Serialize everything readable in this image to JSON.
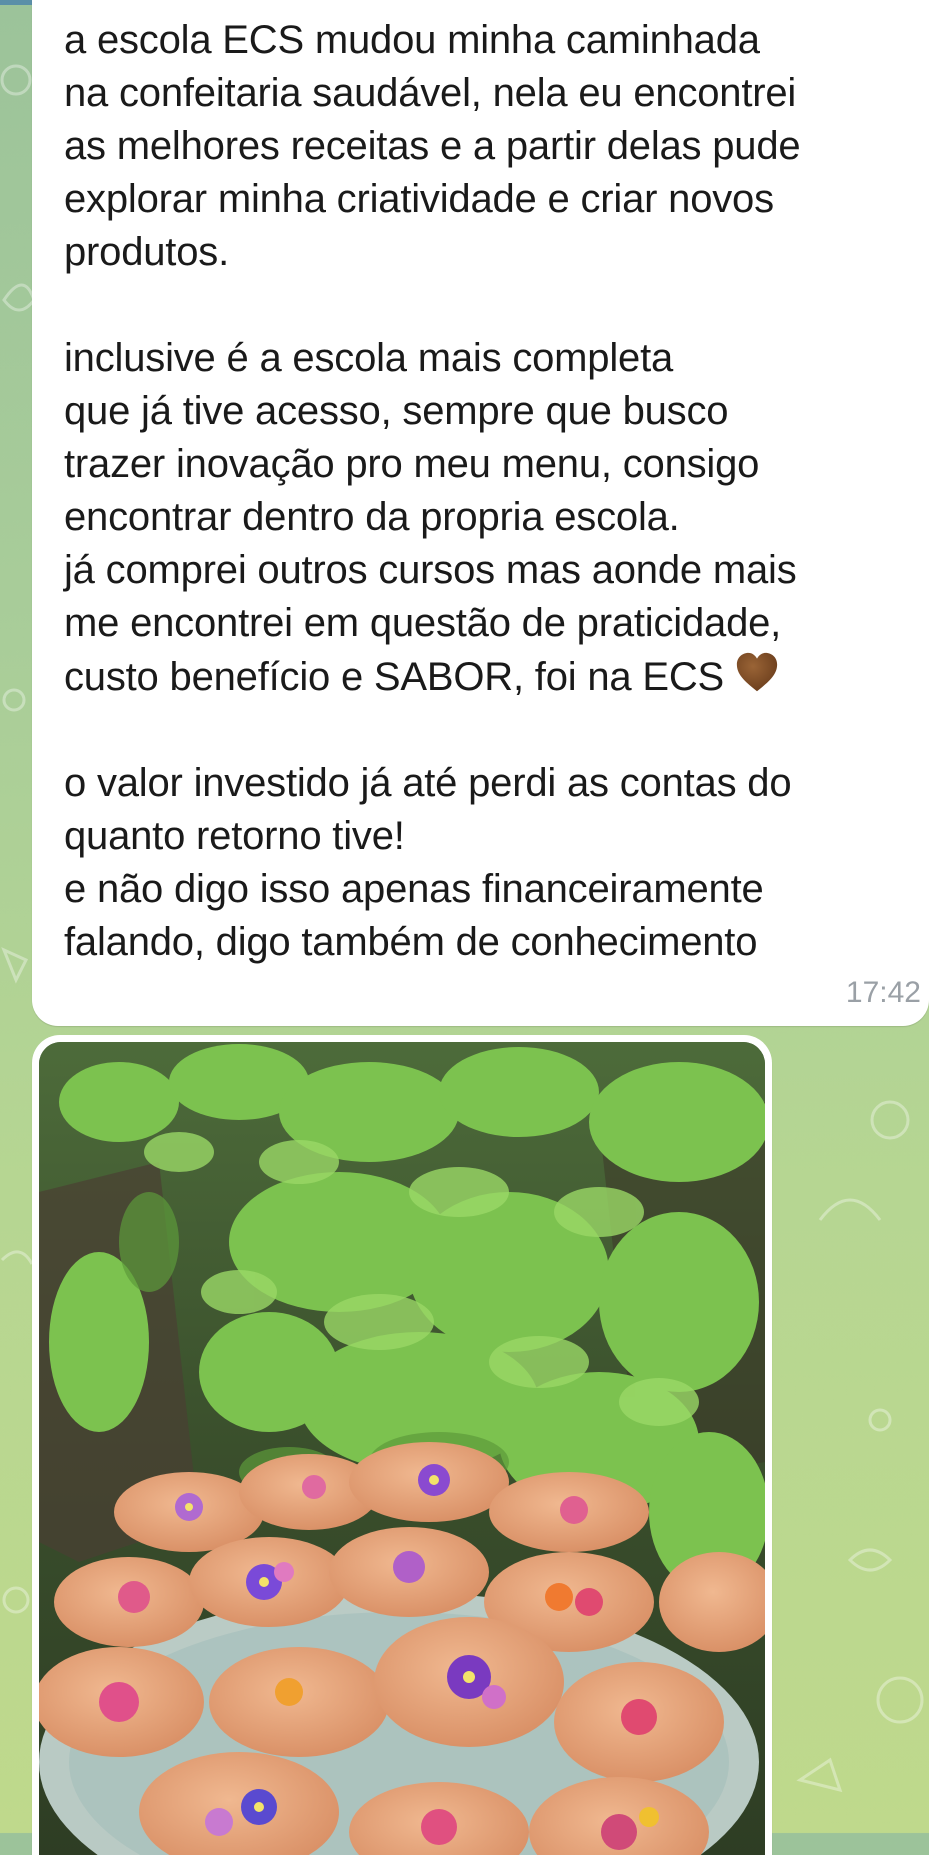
{
  "message": {
    "paragraph_1": "a escola ECS mudou minha caminhada\nna confeitaria saudável, nela eu encontrei\nas melhores receitas e a partir delas pude\nexplorar minha criatividade e criar novos\nprodutos.",
    "paragraph_2": "inclusive é a escola mais completa\nque já tive acesso, sempre que busco\ntrazer inovação pro meu menu, consigo\nencontrar dentro da propria escola.\njá comprei outros cursos mas aonde mais\nme encontrei em questão de praticidade,\ncusto benefício e SABOR, foi na ECS",
    "paragraph_3": "o valor investido já até perdi as contas do\nquanto retorno tive!\ne não digo isso apenas financeiramente\nfalando, digo também de conhecimento",
    "time": "17:42",
    "emoji": "brown-heart-icon"
  },
  "photo": {
    "subject": "cookies-with-edible-flowers-photo"
  },
  "colors": {
    "bubble": "#ffffff",
    "text": "#1a1a1a",
    "time": "#9aa0a6",
    "heart": "#7a4a26",
    "wallpaper": "#a9cd99"
  }
}
